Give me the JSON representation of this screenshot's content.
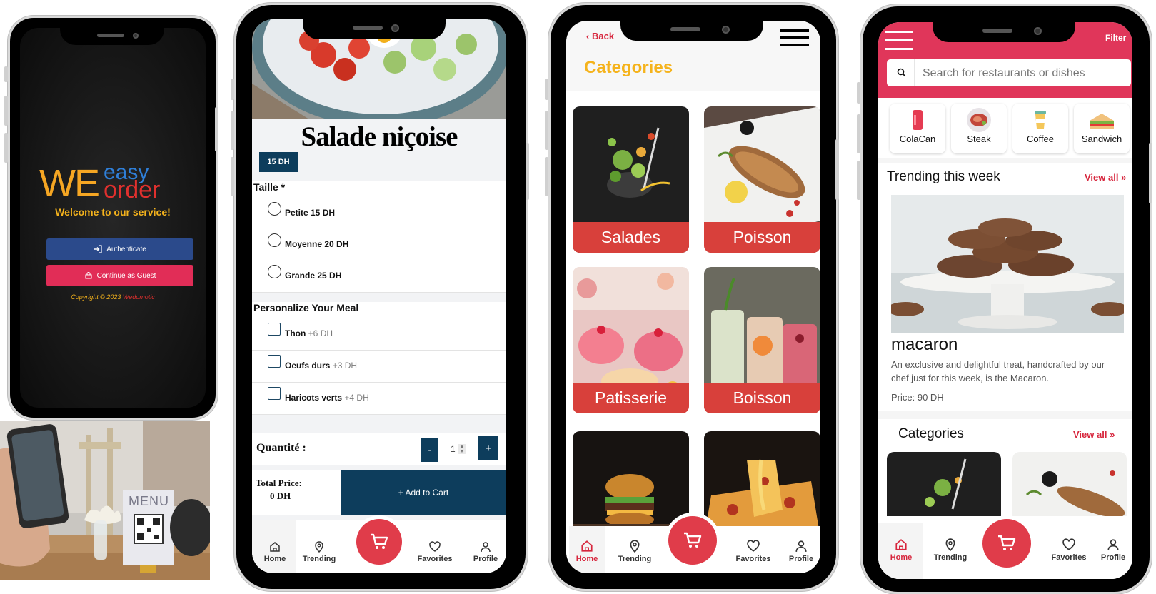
{
  "colors": {
    "brand_red": "#e03c4a",
    "navy": "#0d3d5c",
    "amber": "#f5b31c",
    "blue": "#2f7fd8"
  },
  "phone1": {
    "logo_we": "WE",
    "logo_easy": "easy",
    "logo_order": "order",
    "welcome": "Welcome to our service!",
    "authenticate_label": "Authenticate",
    "guest_label": "Continue as Guest",
    "copyright_prefix": "Copyright © 2023",
    "copyright_brand": "Wedomotic"
  },
  "photo": {
    "menu_sign_text": "MENU"
  },
  "phone2": {
    "dish_title": "Salade niçoise",
    "price_badge": "15 DH",
    "size_heading": "Taille *",
    "size_options": [
      {
        "label": "Petite 15 DH"
      },
      {
        "label": "Moyenne 20 DH"
      },
      {
        "label": "Grande 25 DH"
      }
    ],
    "personalize_heading": "Personalize Your Meal",
    "extras": [
      {
        "label": "Thon",
        "price": "+6 DH"
      },
      {
        "label": "Oeufs durs",
        "price": "+3 DH"
      },
      {
        "label": "Haricots verts",
        "price": "+4 DH"
      }
    ],
    "quantity_label": "Quantité :",
    "minus": "-",
    "plus": "+",
    "quantity_value": "1",
    "total_label": "Total Price:",
    "total_value": "0 DH",
    "add_to_cart": "+ Add to Cart",
    "nav": {
      "home": "Home",
      "trending": "Trending",
      "favorites": "Favorites",
      "profile": "Profile"
    }
  },
  "phone3": {
    "back_label": "Back",
    "title": "Categories",
    "categories": [
      {
        "label": "Salades"
      },
      {
        "label": "Poisson"
      },
      {
        "label": "Patisserie"
      },
      {
        "label": "Boisson"
      }
    ],
    "nav": {
      "home": "Home",
      "trending": "Trending",
      "favorites": "Favorites",
      "profile": "Profile"
    }
  },
  "phone4": {
    "filter_label": "Filter",
    "search_placeholder": "Search for restaurants or dishes",
    "chips": [
      {
        "label": "ColaCan",
        "icon": "cola-can-icon"
      },
      {
        "label": "Steak",
        "icon": "steak-icon"
      },
      {
        "label": "Coffee",
        "icon": "coffee-icon"
      },
      {
        "label": "Sandwich",
        "icon": "sandwich-icon"
      }
    ],
    "trending_heading": "Trending this week",
    "view_all": "View all",
    "trending_item": {
      "name": "macaron",
      "description": "An exclusive and delightful treat, handcrafted by our chef just for this week, is the Macaron.",
      "price": "Price: 90 DH"
    },
    "categories_heading": "Categories",
    "nav": {
      "home": "Home",
      "trending": "Trending",
      "favorites": "Favorites",
      "profile": "Profile"
    }
  }
}
